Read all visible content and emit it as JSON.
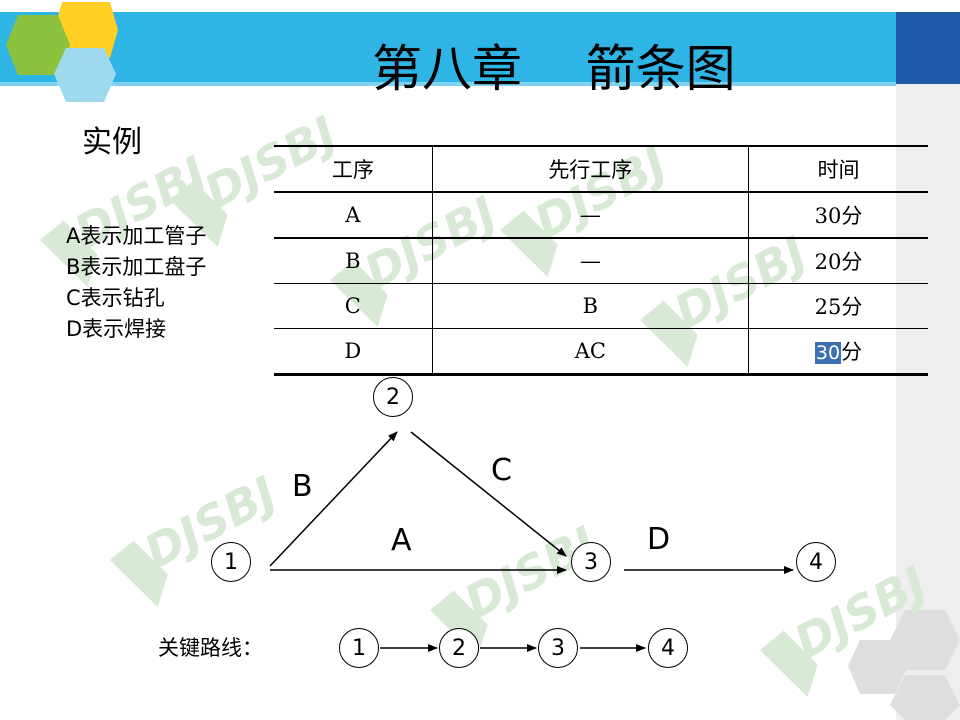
{
  "title": "第八章    箭条图",
  "example_label": "实例",
  "legend": [
    "A表示加工管子",
    "B表示加工盘子",
    "C表示钻孔",
    "D表示焊接"
  ],
  "table": {
    "headers": [
      "工序",
      "先行工序",
      "时间"
    ],
    "rows": [
      [
        "A",
        "—",
        "30分"
      ],
      [
        "B",
        "—",
        "20分"
      ],
      [
        "C",
        "B",
        "25分"
      ],
      [
        "D",
        "AC",
        "30",
        "分"
      ]
    ]
  },
  "network": {
    "nodes": [
      "1",
      "2",
      "3",
      "4"
    ],
    "arrows": [
      {
        "label": "B",
        "from": "1",
        "to": "2"
      },
      {
        "label": "C",
        "from": "2",
        "to": "3"
      },
      {
        "label": "A",
        "from": "1",
        "to": "3"
      },
      {
        "label": "D",
        "from": "3",
        "to": "4"
      }
    ]
  },
  "critical_path": {
    "label": "关键路线：",
    "nodes": [
      "1",
      "2",
      "3",
      "4"
    ]
  },
  "watermark": "DJSBJ",
  "colors": {
    "header_bar": "#2fb4e6",
    "corner_box": "#1f5aa8",
    "highlight": "#3d6fb3",
    "watermark": "#d8ead5"
  }
}
